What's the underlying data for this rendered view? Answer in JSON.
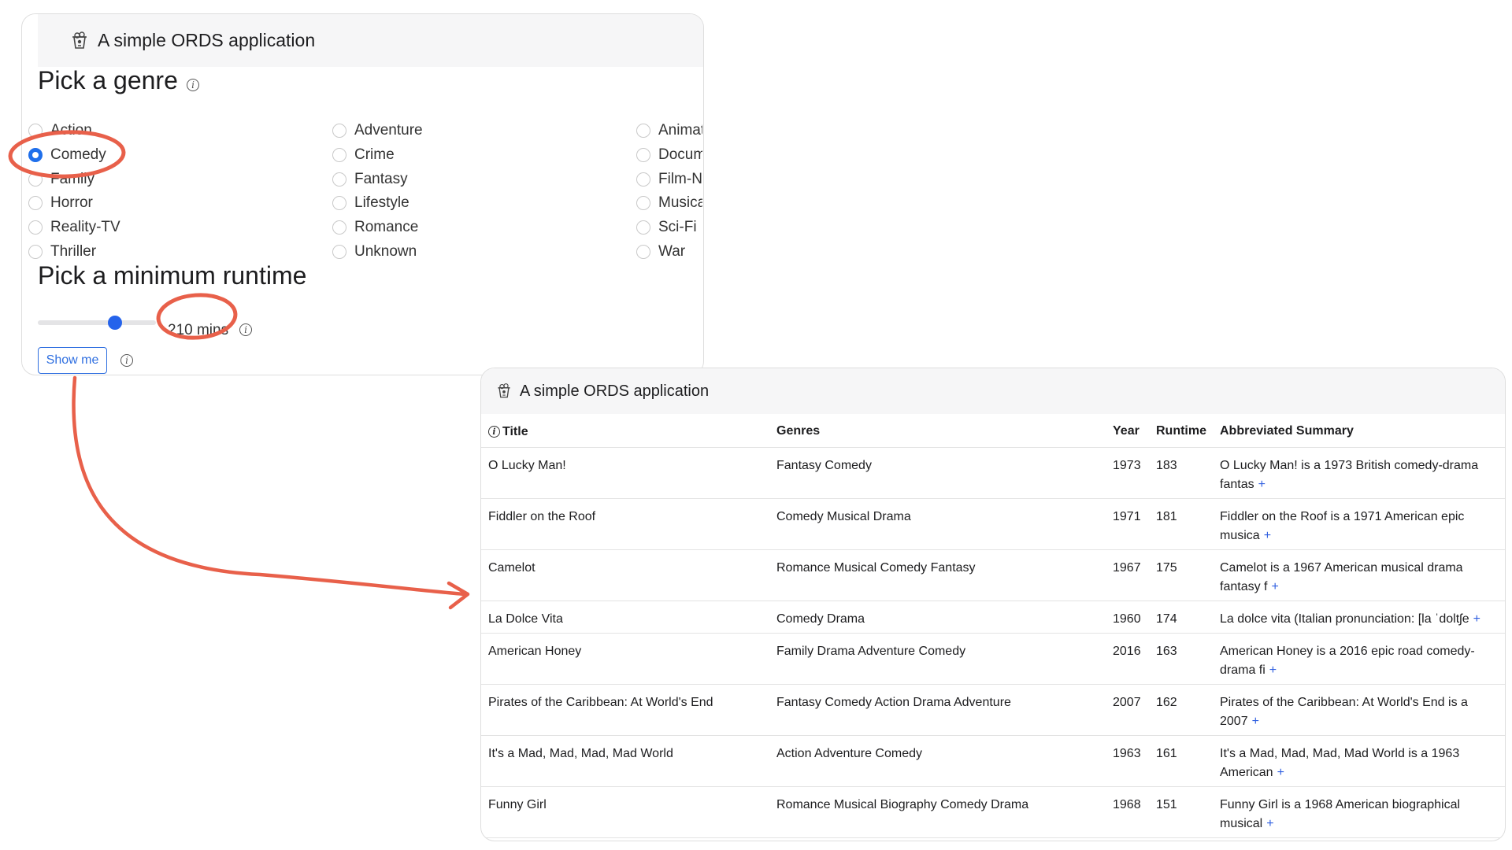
{
  "app": {
    "title": "A simple ORDS application"
  },
  "form": {
    "genre_heading": "Pick a genre",
    "runtime_heading": "Pick a minimum runtime",
    "selected_genre": "Comedy",
    "genres_col1": [
      "Action",
      "Comedy",
      "Family",
      "Horror",
      "Reality-TV",
      "Thriller"
    ],
    "genres_col2": [
      "Adventure",
      "Crime",
      "Fantasy",
      "Lifestyle",
      "Romance",
      "Unknown"
    ],
    "genres_col3": [
      "Animat",
      "Docum",
      "Film-N",
      "Musica",
      "Sci-Fi",
      "War"
    ],
    "runtime_value": "210 mins",
    "runtime_level": 0.55,
    "show_button": "Show me"
  },
  "table": {
    "headers": [
      "Title",
      "Genres",
      "Year",
      "Runtime",
      "Abbreviated Summary"
    ],
    "more_symbol": "+",
    "rows": [
      {
        "title": "O Lucky Man!",
        "genres": "Fantasy Comedy",
        "year": "1973",
        "runtime": "183",
        "summary": "O Lucky Man! is a 1973 British comedy-drama fantas"
      },
      {
        "title": "Fiddler on the Roof",
        "genres": "Comedy Musical Drama",
        "year": "1971",
        "runtime": "181",
        "summary": "Fiddler on the Roof is a 1971 American epic musica"
      },
      {
        "title": "Camelot",
        "genres": "Romance Musical Comedy Fantasy",
        "year": "1967",
        "runtime": "175",
        "summary": "Camelot is a 1967 American musical drama fantasy f"
      },
      {
        "title": "La Dolce Vita",
        "genres": "Comedy Drama",
        "year": "1960",
        "runtime": "174",
        "summary": "La dolce vita (Italian pronunciation: [la ˈdoltʃe"
      },
      {
        "title": "American Honey",
        "genres": "Family Drama Adventure Comedy",
        "year": "2016",
        "runtime": "163",
        "summary": "American Honey is a 2016 epic road comedy-drama fi"
      },
      {
        "title": "Pirates of the Caribbean: At World's End",
        "genres": "Fantasy Comedy Action Drama Adventure",
        "year": "2007",
        "runtime": "162",
        "summary": "Pirates of the Caribbean: At World's End is a 2007"
      },
      {
        "title": "It's a Mad, Mad, Mad, Mad World",
        "genres": "Action Adventure Comedy",
        "year": "1963",
        "runtime": "161",
        "summary": "It's a Mad, Mad, Mad, Mad World is a 1963 American"
      },
      {
        "title": "Funny Girl",
        "genres": "Romance Musical Biography Comedy Drama",
        "year": "1968",
        "runtime": "151",
        "summary": "Funny Girl is a 1968 American biographical musical"
      }
    ]
  },
  "colors": {
    "accent": "#2563eb",
    "annotation": "#e8604a"
  }
}
